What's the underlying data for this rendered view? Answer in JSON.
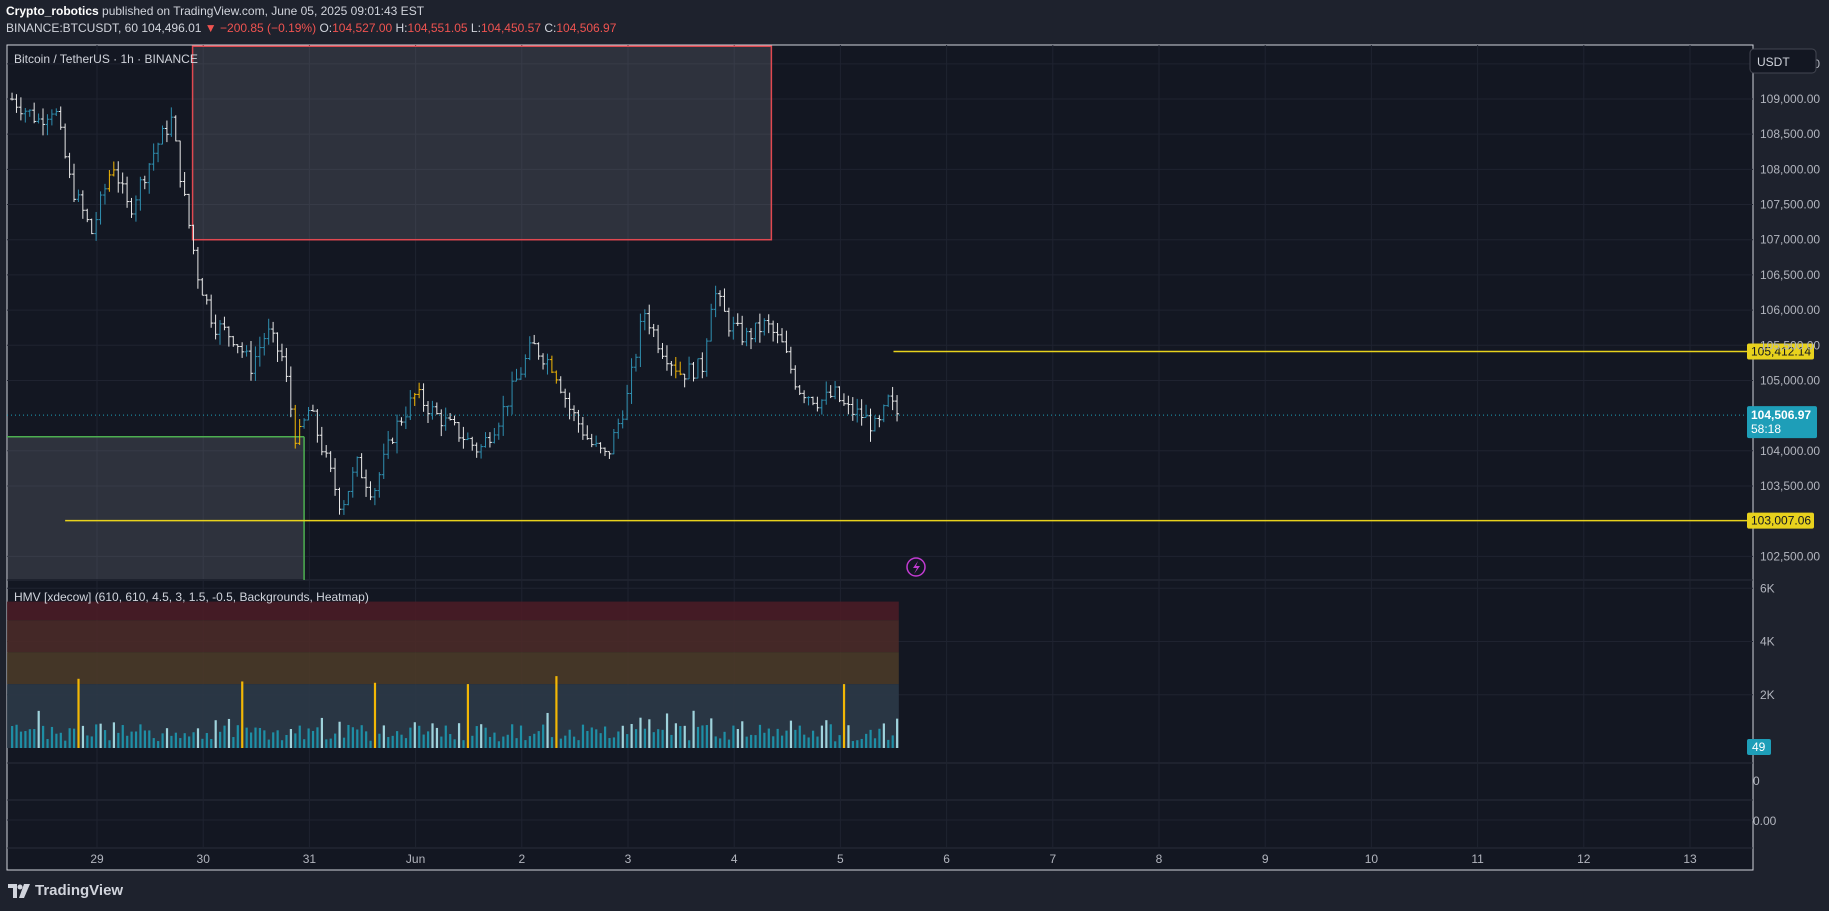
{
  "header": {
    "author": "Crypto_robotics",
    "published": " published on TradingView.com, June 05, 2025 09:01:43 EST",
    "symbol": "BINANCE:BTCUSDT, 60",
    "last": "104,496.01",
    "change": "−200.85 (−0.19%)",
    "o_label": "O:",
    "o": "104,527.00",
    "h_label": "H:",
    "h": "104,551.05",
    "l_label": "L:",
    "l": "104,450.57",
    "c_label": "C:",
    "c": "104,506.97"
  },
  "chart_title": "Bitcoin / TetherUS · 1h · BINANCE",
  "currency_button": "USDT",
  "indicator_label": "HMV [xdecow] (610, 610, 4.5, 3, 1.5, -0.5, Backgrounds, Heatmap)",
  "footer_brand": "TradingView",
  "colors": {
    "background": "#131722",
    "candle_up": "#2f8fb0",
    "candle_down": "#e8e8e8",
    "candle_highlight": "#f2b705",
    "level_line": "#e8d21d",
    "supply_zone_border": "#e04850",
    "demand_zone_border": "#4caf50",
    "price_badge": "#1e9eb8"
  },
  "chart_data": [
    {
      "type": "candlestick",
      "title": "Bitcoin / TetherUS · 1h · BINANCE",
      "x_tick_labels": [
        "29",
        "30",
        "31",
        "Jun",
        "2",
        "3",
        "4",
        "5",
        "6",
        "7",
        "8",
        "9",
        "10",
        "11",
        "12",
        "13"
      ],
      "y_range": [
        102350,
        109750
      ],
      "y_tick_labels": [
        "109,500.00",
        "109,000.00",
        "108,500.00",
        "108,000.00",
        "107,500.00",
        "107,000.00",
        "106,500.00",
        "106,000.00",
        "105,500.00",
        "105,000.00",
        "104,000.00",
        "103,500.00",
        "102,500.00"
      ],
      "y_tick_values": [
        109500,
        109000,
        108500,
        108000,
        107500,
        107000,
        106500,
        106000,
        105500,
        105000,
        104000,
        103500,
        102500
      ],
      "price_close_path": [
        {
          "day": 28.2,
          "price": 109000
        },
        {
          "day": 28.45,
          "price": 108700
        },
        {
          "day": 28.6,
          "price": 108900
        },
        {
          "day": 28.75,
          "price": 107800
        },
        {
          "day": 28.95,
          "price": 107100
        },
        {
          "day": 29.15,
          "price": 108100
        },
        {
          "day": 29.3,
          "price": 107400
        },
        {
          "day": 29.55,
          "price": 108300
        },
        {
          "day": 29.7,
          "price": 108700
        },
        {
          "day": 29.82,
          "price": 107600
        },
        {
          "day": 29.95,
          "price": 106500
        },
        {
          "day": 30.1,
          "price": 105800
        },
        {
          "day": 30.3,
          "price": 105600
        },
        {
          "day": 30.45,
          "price": 105200
        },
        {
          "day": 30.6,
          "price": 105700
        },
        {
          "day": 30.75,
          "price": 105300
        },
        {
          "day": 30.88,
          "price": 104100
        },
        {
          "day": 31.0,
          "price": 104600
        },
        {
          "day": 31.15,
          "price": 103900
        },
        {
          "day": 31.3,
          "price": 103200
        },
        {
          "day": 31.45,
          "price": 103800
        },
        {
          "day": 31.6,
          "price": 103400
        },
        {
          "day": 31.8,
          "price": 104300
        },
        {
          "day": 32.0,
          "price": 104800
        },
        {
          "day": 32.2,
          "price": 104500
        },
        {
          "day": 32.45,
          "price": 104200
        },
        {
          "day": 32.6,
          "price": 104000
        },
        {
          "day": 32.8,
          "price": 104500
        },
        {
          "day": 32.95,
          "price": 105000
        },
        {
          "day": 33.1,
          "price": 105500
        },
        {
          "day": 33.3,
          "price": 105200
        },
        {
          "day": 33.45,
          "price": 104600
        },
        {
          "day": 33.65,
          "price": 104100
        },
        {
          "day": 33.8,
          "price": 103900
        },
        {
          "day": 34.0,
          "price": 104800
        },
        {
          "day": 34.15,
          "price": 106000
        },
        {
          "day": 34.3,
          "price": 105500
        },
        {
          "day": 34.5,
          "price": 105100
        },
        {
          "day": 34.7,
          "price": 105200
        },
        {
          "day": 34.8,
          "price": 106300
        },
        {
          "day": 34.95,
          "price": 105800
        },
        {
          "day": 35.1,
          "price": 105600
        },
        {
          "day": 35.3,
          "price": 105800
        },
        {
          "day": 35.45,
          "price": 105500
        },
        {
          "day": 35.6,
          "price": 104900
        },
        {
          "day": 35.8,
          "price": 104700
        },
        {
          "day": 35.95,
          "price": 104800
        },
        {
          "day": 36.05,
          "price": 104600
        },
        {
          "day": 36.2,
          "price": 104500
        },
        {
          "day": 36.35,
          "price": 104300
        },
        {
          "day": 36.45,
          "price": 104700
        },
        {
          "day": 36.55,
          "price": 104500
        }
      ],
      "price_levels": [
        {
          "value": 105412.14,
          "label": "105,412.14"
        },
        {
          "value": 103007.06,
          "label": "103,007.06"
        }
      ],
      "current_price": {
        "label": "104,506.97",
        "value": 104506.97,
        "countdown": "58:18"
      },
      "zones": [
        {
          "kind": "supply",
          "day_from": 29.9,
          "day_to": 35.35,
          "price_from": 107000,
          "price_top": 109750
        },
        {
          "kind": "demand",
          "day_from": 28.0,
          "day_to": 30.95,
          "price_from": 102450,
          "price_top": 104200
        }
      ]
    },
    {
      "type": "bar",
      "title": "HMV [xdecow] (610, 610, 4.5, 3, 1.5, -0.5, Backgrounds, Heatmap)",
      "y_tick_labels": [
        "6K",
        "4K",
        "2K"
      ],
      "y_tick_values": [
        6000,
        4000,
        2000
      ],
      "y_range": [
        0,
        6000
      ],
      "last_value": "49",
      "heatmap_bands": [
        {
          "from": 4800,
          "to": 5500,
          "color": "#4a1c26"
        },
        {
          "from": 3600,
          "to": 4800,
          "color": "#4a2a28"
        },
        {
          "from": 2400,
          "to": 3600,
          "color": "#4a3a28"
        },
        {
          "from": 0,
          "to": 2400,
          "color": "#2c3a48"
        }
      ],
      "volume_approx": "hourly volume mostly 300–1200, spikes up to ~2600 (highlighted yellow)"
    },
    {
      "type": "line",
      "title": "",
      "y_tick_labels": [
        "0",
        "0.00"
      ],
      "y_tick_values": [
        0,
        0
      ]
    }
  ]
}
